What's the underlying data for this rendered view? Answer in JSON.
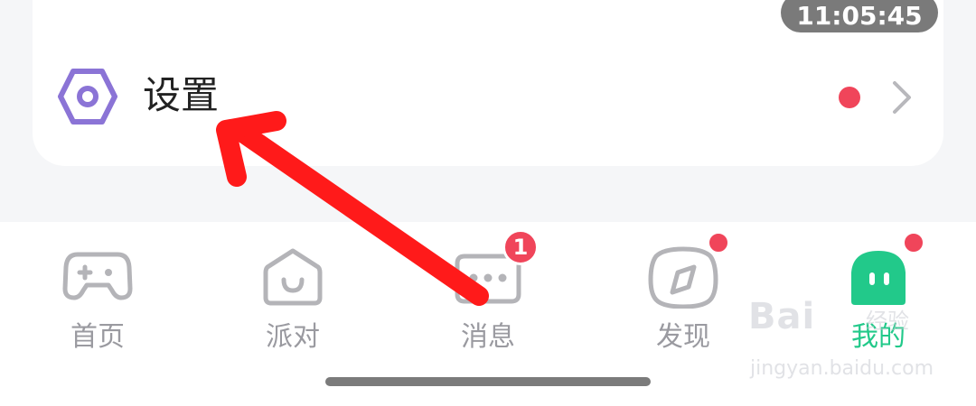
{
  "status": {
    "time": "11:05:45"
  },
  "settings": {
    "label": "设置",
    "icon": "settings-hex-icon",
    "has_dot": true
  },
  "tabs": [
    {
      "label": "首页",
      "icon": "gamepad-icon",
      "active": false
    },
    {
      "label": "派对",
      "icon": "house-smile-icon",
      "active": false
    },
    {
      "label": "消息",
      "icon": "chat-bubble-icon",
      "active": false,
      "badge": "1"
    },
    {
      "label": "发现",
      "icon": "compass-icon",
      "active": false,
      "dot": true
    },
    {
      "label": "我的",
      "icon": "ghost-face-icon",
      "active": true,
      "dot": true
    }
  ],
  "watermark": {
    "brand": "Bai",
    "sub": "经验",
    "url": "jingyan.baidu.com"
  },
  "colors": {
    "accent_green": "#22c98a",
    "badge_red": "#f0455a",
    "icon_purple": "#8b74d6",
    "arrow_red": "#ff1a1a"
  }
}
